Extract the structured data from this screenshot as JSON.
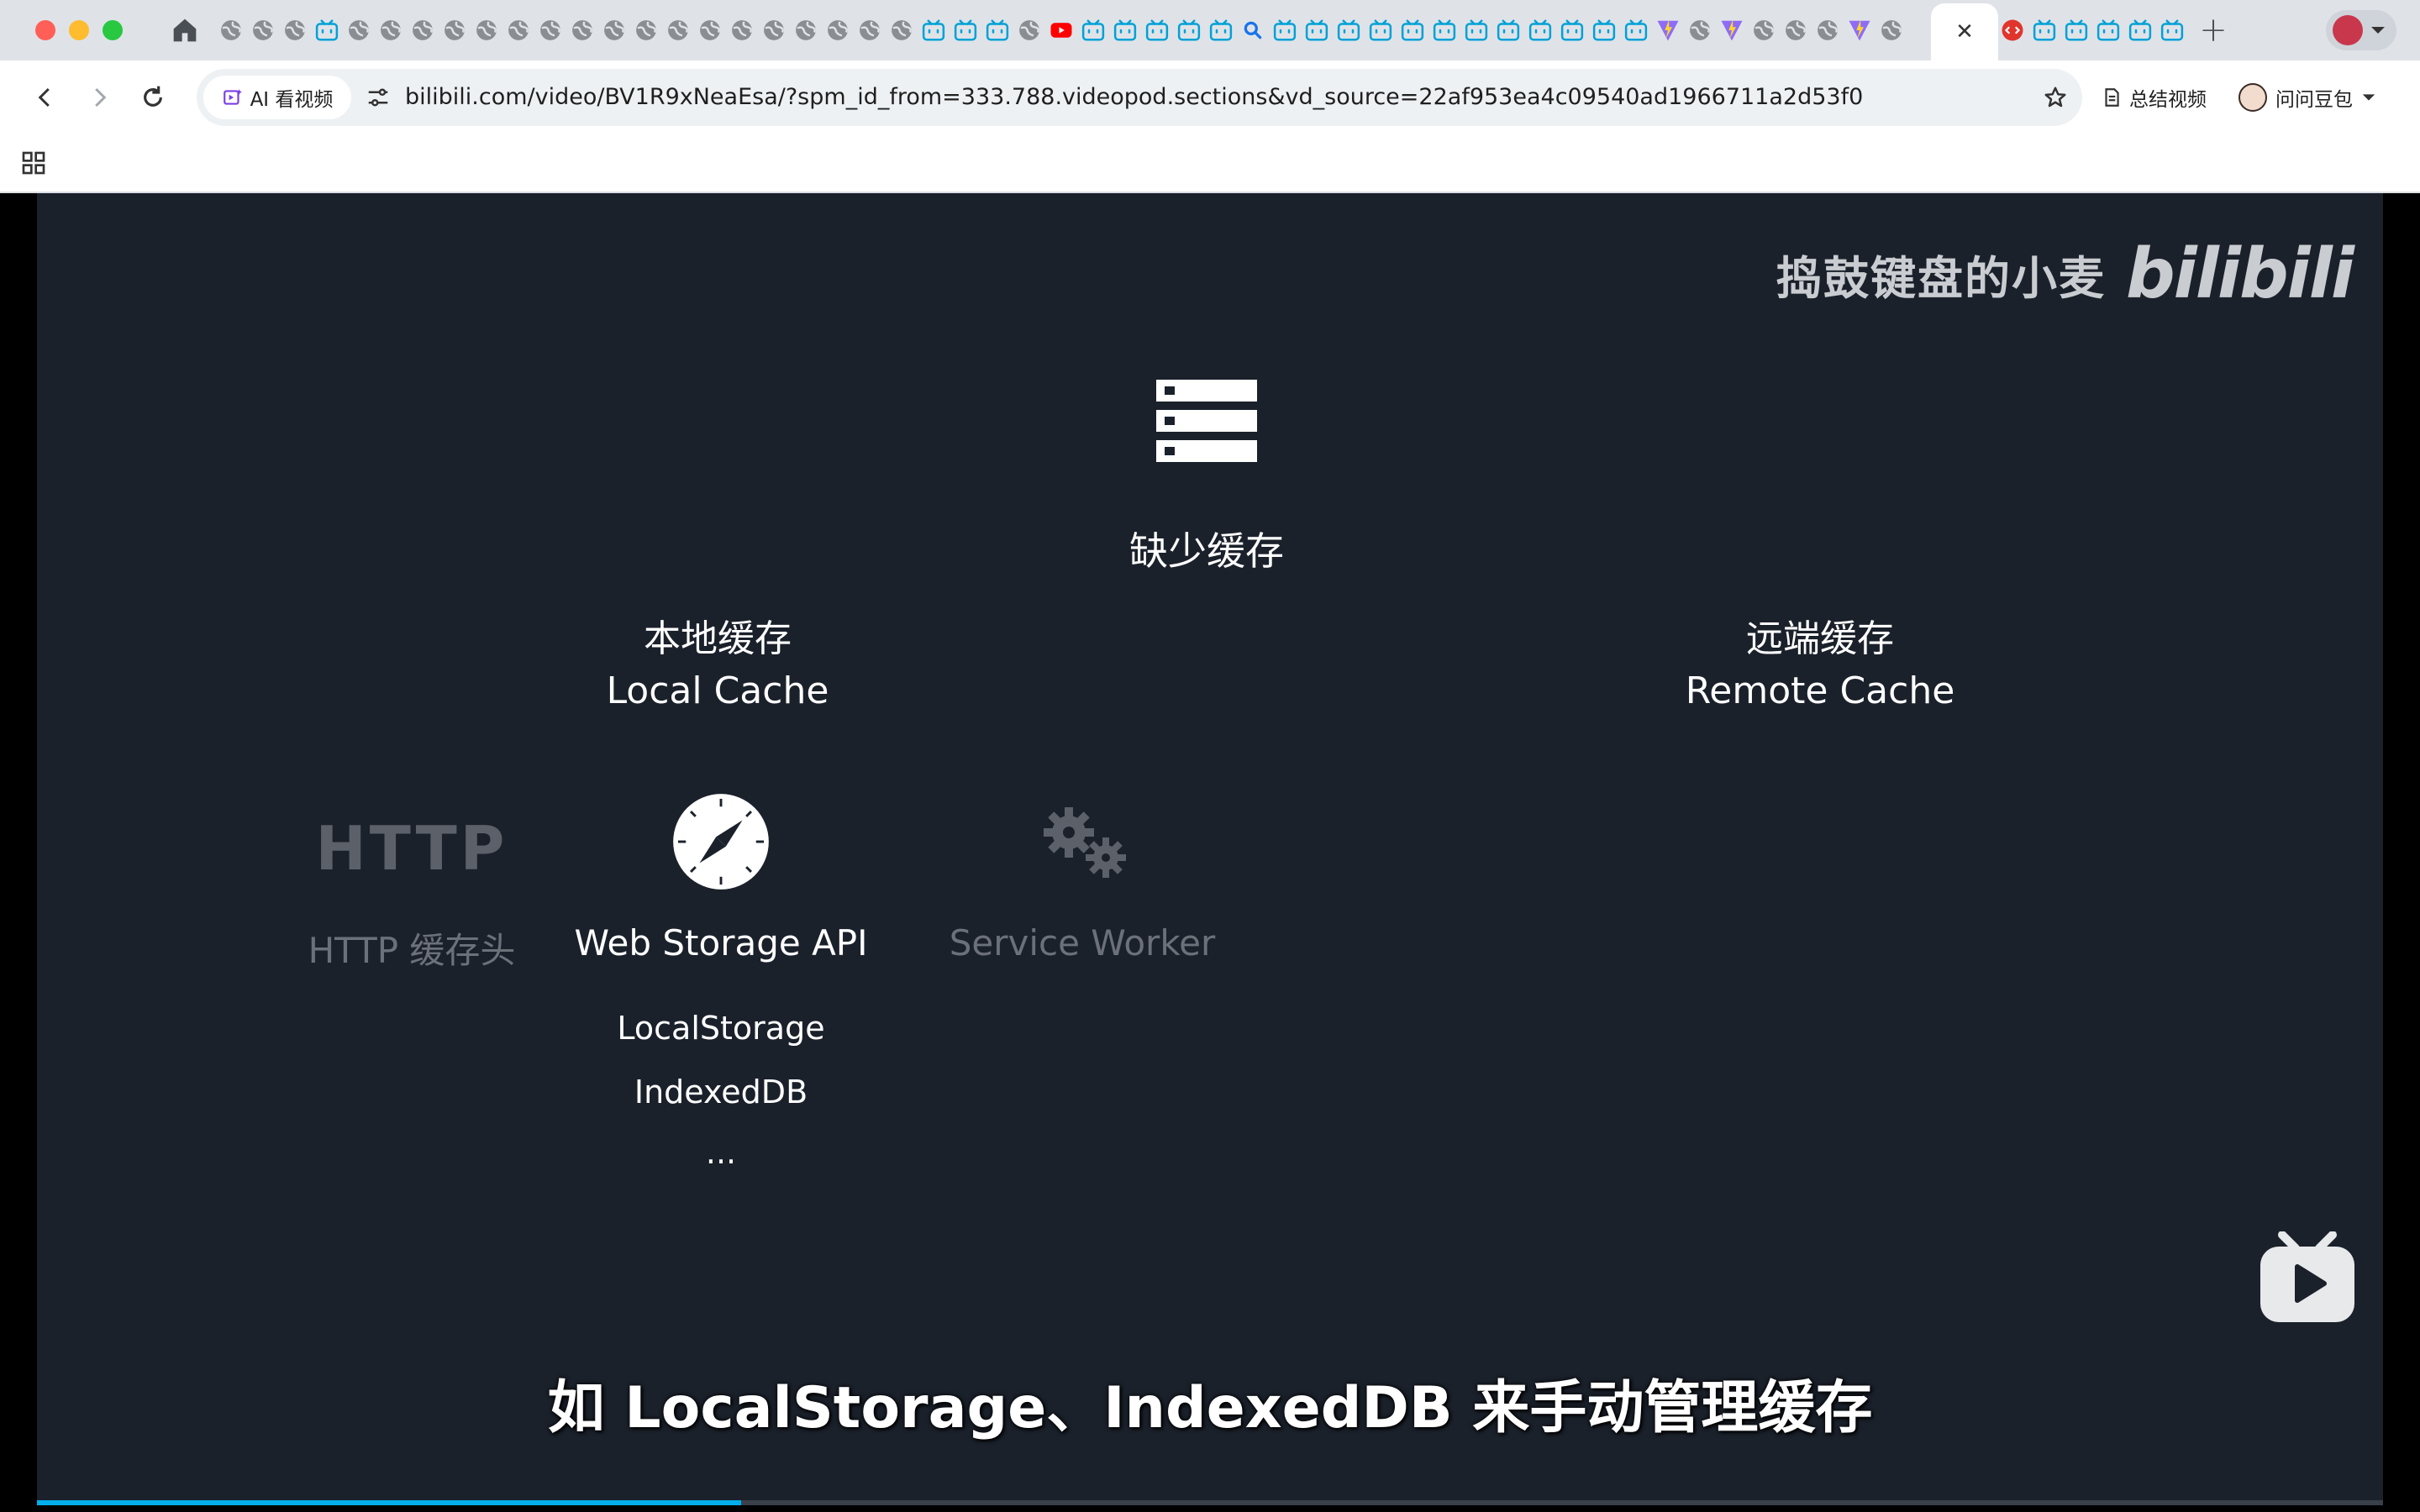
{
  "browser": {
    "pinned_tab_icons": [
      "globe",
      "globe",
      "globe",
      "bilibili",
      "globe",
      "globe",
      "globe",
      "globe",
      "globe",
      "globe",
      "globe",
      "globe",
      "globe",
      "globe",
      "globe",
      "globe",
      "globe",
      "globe",
      "globe",
      "globe",
      "globe",
      "globe",
      "bilibili",
      "bilibili",
      "bilibili",
      "globe",
      "youtube",
      "bilibili",
      "bilibili",
      "bilibili",
      "bilibili",
      "bilibili",
      "search",
      "bilibili",
      "bilibili",
      "bilibili",
      "bilibili",
      "bilibili",
      "bilibili",
      "bilibili",
      "bilibili",
      "bilibili",
      "bilibili",
      "bilibili",
      "bilibili",
      "vite",
      "globe",
      "vite",
      "globe",
      "globe",
      "globe",
      "vite",
      "globe"
    ],
    "after_active_tab_icons": [
      "dev-red",
      "bilibili",
      "bilibili",
      "bilibili",
      "bilibili",
      "bilibili"
    ],
    "active_tab_close": "✕",
    "new_tab": "+",
    "ai_chip_label": "AI 看视频",
    "url": "bilibili.com/video/BV1R9xNeaEsa/?spm_id_from=333.788.videopod.sections&vd_source=22af953ea4c09540ad1966711a2d53f0",
    "summarize_label": "总结视频",
    "doubao_label": "问问豆包",
    "colors": {
      "accent": "#00aeec",
      "slide_bg": "#1b212b"
    }
  },
  "video": {
    "watermark_text": "捣鼓键盘的小麦",
    "watermark_logo": "bilibili",
    "title": "缺少缓存",
    "local": {
      "zh": "本地缓存",
      "en": "Local Cache"
    },
    "remote": {
      "zh": "远端缓存",
      "en": "Remote Cache"
    },
    "methods": {
      "http": {
        "icon_text": "HTTP",
        "label": "HTTP 缓存头"
      },
      "web_storage": {
        "label": "Web Storage API",
        "items": [
          "LocalStorage",
          "IndexedDB",
          "..."
        ]
      },
      "service_worker": {
        "label": "Service Worker"
      }
    },
    "subtitle": "如 LocalStorage、IndexedDB 来手动管理缓存",
    "progress": 0.3
  }
}
